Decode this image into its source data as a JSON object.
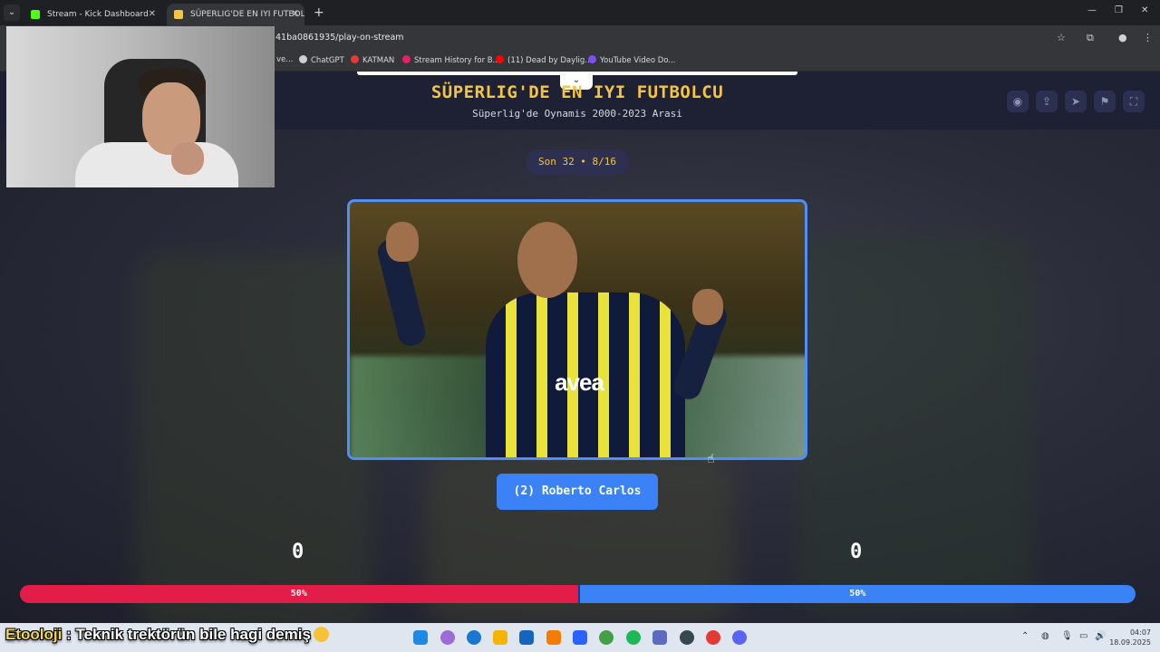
{
  "browser": {
    "tabs": [
      {
        "title": "Stream - Kick Dashboard",
        "favicon_color": "#53fc18"
      },
      {
        "title": "SÜPERLIG'DE EN IYI FUTBOLCU",
        "favicon_color": "#f4c542"
      }
    ],
    "url_visible": "41ba0861935/play-on-stream",
    "bookmarks": [
      {
        "label": "ve...",
        "color": "#8a8a8a"
      },
      {
        "label": "ChatGPT",
        "color": "#cfcfcf"
      },
      {
        "label": "KATMAN",
        "color": "#e53935"
      },
      {
        "label": "Stream History for B...",
        "color": "#e91e63"
      },
      {
        "label": "(11) Dead by Daylig...",
        "color": "#ff0000"
      },
      {
        "label": "YouTube Video Do...",
        "color": "#7c4dff"
      }
    ]
  },
  "game": {
    "title": "SÜPERLIG'DE EN IYI FUTBOLCU",
    "subtitle": "Süperlig'de Oynamis 2000-2023 Arasi",
    "round_label": "Son 32 • 8/16",
    "candidate_label": "(2) Roberto Carlos",
    "card_sponsor_text": "avea",
    "left_score": "0",
    "right_score": "0",
    "left_percent_label": "50%",
    "right_percent_label": "50%",
    "left_percent": 50,
    "right_percent": 50,
    "colors": {
      "accent": "#f4c542",
      "blue": "#3b82f6",
      "red": "#e11d48"
    }
  },
  "header_buttons": [
    {
      "name": "eye-icon",
      "glyph": "◉"
    },
    {
      "name": "share-icon",
      "glyph": "⇪"
    },
    {
      "name": "send-icon",
      "glyph": "➤"
    },
    {
      "name": "flag-icon",
      "glyph": "⚑"
    },
    {
      "name": "fullscreen-icon",
      "glyph": "⛶"
    }
  ],
  "chat": {
    "user": "Etooloji",
    "separator": " : ",
    "message": "Teknik trektörün bile hagi demiş"
  },
  "taskbar": {
    "time": "04:07",
    "date": "18.09.2025"
  }
}
